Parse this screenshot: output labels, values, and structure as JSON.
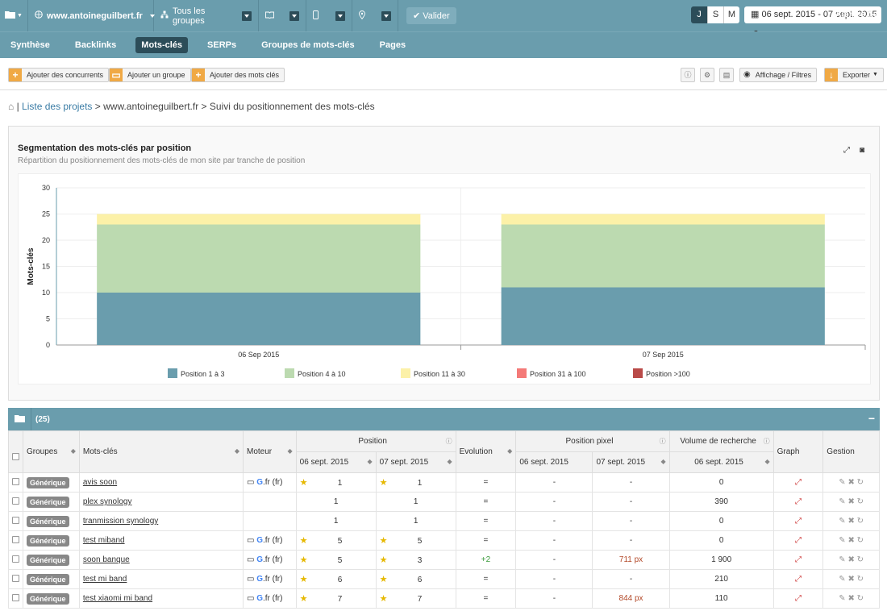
{
  "topbar": {
    "site": "www.antoineguilbert.fr",
    "groups": "Tous les groupes",
    "validate": "Valider",
    "period_j": "J",
    "period_s": "S",
    "period_m": "M",
    "daterange": "06 sept. 2015 - 07 sept. 2015"
  },
  "nav": {
    "items": [
      "Synthèse",
      "Backlinks",
      "Mots-clés",
      "SERPs",
      "Groupes de mots-clés",
      "Pages"
    ],
    "active": "Mots-clés",
    "alerts_label": "Alertes",
    "alerts_count": "0"
  },
  "toolbar": {
    "add_competitors": "Ajouter des concurrents",
    "add_group": "Ajouter un groupe",
    "add_keywords": "Ajouter des mots clés",
    "display_filters": "Affichage / Filtres",
    "export": "Exporter"
  },
  "breadcrumb": {
    "projects": "Liste des projets",
    "site": "www.antoineguilbert.fr",
    "page": "Suivi du positionnement des mots-clés"
  },
  "chart_panel": {
    "title": "Segmentation des mots-clés par position",
    "subtitle": "Répartition du positionnement des mots-clés de mon site par tranche de position"
  },
  "chart_data": {
    "type": "bar",
    "stacked": true,
    "categories": [
      "06 Sep 2015",
      "07 Sep 2015"
    ],
    "series": [
      {
        "name": "Position 1 à 3",
        "values": [
          10,
          11
        ],
        "color": "#6a9dad"
      },
      {
        "name": "Position 4 à 10",
        "values": [
          13,
          12
        ],
        "color": "#bcdab0"
      },
      {
        "name": "Position 11 à 30",
        "values": [
          2,
          2
        ],
        "color": "#fcf1a8"
      },
      {
        "name": "Position 31 à 100",
        "values": [
          0,
          0
        ],
        "color": "#f47a78"
      },
      {
        "name": "Position >100",
        "values": [
          0,
          0
        ],
        "color": "#b94a48"
      }
    ],
    "ylabel": "Mots-clés",
    "xlabel": "",
    "ylim": [
      0,
      30
    ],
    "yticks": [
      0,
      5,
      10,
      15,
      20,
      25,
      30
    ],
    "legend": "bottom"
  },
  "table": {
    "count": "(25)",
    "headers": {
      "groups": "Groupes",
      "keywords": "Mots-clés",
      "engine": "Moteur",
      "position": "Position",
      "pos_d1": "06 sept. 2015",
      "pos_d2": "07 sept. 2015",
      "evolution": "Evolution",
      "pixel": "Position pixel",
      "px_d1": "06 sept. 2015",
      "px_d2": "07 sept. 2015",
      "volume": "Volume de recherche",
      "vol_d1": "06 sept. 2015",
      "graph": "Graph",
      "manage": "Gestion"
    },
    "rows": [
      {
        "group": "Générique",
        "keyword": "avis soon",
        "engine": ".fr (fr)",
        "p1": "1",
        "p1star": true,
        "p2": "1",
        "p2star": true,
        "evo": "=",
        "px1": "-",
        "px2": "-",
        "vol": "0",
        "hasEngine": true
      },
      {
        "group": "Générique",
        "keyword": "plex synology",
        "engine": "",
        "p1": "1",
        "p1star": false,
        "p2": "1",
        "p2star": false,
        "evo": "=",
        "px1": "-",
        "px2": "-",
        "vol": "390",
        "hasEngine": false
      },
      {
        "group": "Générique",
        "keyword": "tranmission synology",
        "engine": "",
        "p1": "1",
        "p1star": false,
        "p2": "1",
        "p2star": false,
        "evo": "=",
        "px1": "-",
        "px2": "-",
        "vol": "0",
        "hasEngine": false
      },
      {
        "group": "Générique",
        "keyword": "test miband",
        "engine": ".fr (fr)",
        "p1": "5",
        "p1star": true,
        "p2": "5",
        "p2star": true,
        "evo": "=",
        "px1": "-",
        "px2": "-",
        "vol": "0",
        "hasEngine": true
      },
      {
        "group": "Générique",
        "keyword": "soon banque",
        "engine": ".fr (fr)",
        "p1": "5",
        "p1star": true,
        "p2": "3",
        "p2star": true,
        "evo": "+2",
        "px1": "-",
        "px2": "711 px",
        "vol": "1 900",
        "hasEngine": true
      },
      {
        "group": "Générique",
        "keyword": "test mi band",
        "engine": ".fr (fr)",
        "p1": "6",
        "p1star": true,
        "p2": "6",
        "p2star": true,
        "evo": "=",
        "px1": "-",
        "px2": "-",
        "vol": "210",
        "hasEngine": true
      },
      {
        "group": "Générique",
        "keyword": "test xiaomi mi band",
        "engine": ".fr (fr)",
        "p1": "7",
        "p1star": true,
        "p2": "7",
        "p2star": true,
        "evo": "=",
        "px1": "-",
        "px2": "844 px",
        "vol": "110",
        "hasEngine": true
      }
    ]
  }
}
